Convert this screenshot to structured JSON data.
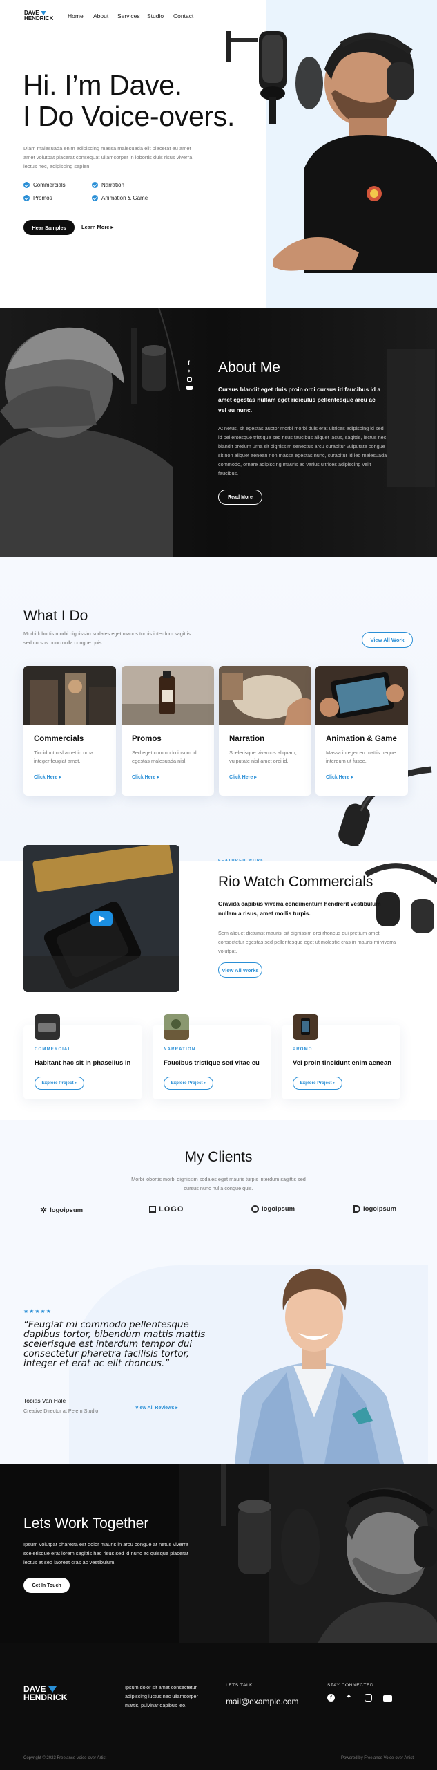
{
  "header": {
    "logo": [
      "DAVE",
      "HENDRICK"
    ],
    "nav": [
      "Home",
      "About",
      "Services",
      "Studio",
      "Contact"
    ]
  },
  "hero": {
    "title_line1": "Hi. I’m Dave.",
    "title_line2": "I Do Voice-overs.",
    "intro": "Diam malesuada enim adipiscing massa malesuada elit placerat eu amet amet volutpat placerat consequat ullamcorper in lobortis duis risus viverra lectus nec, adipiscing sapien.",
    "services": [
      "Commercials",
      "Narration",
      "Promos",
      "Animation & Game"
    ],
    "primary_btn": "Hear Samples",
    "secondary_btn": "Learn More"
  },
  "about": {
    "title": "About Me",
    "lead": "Cursus blandit eget duis proin orci cursus id faucibus id a amet egestas nullam eget ridiculus pellentesque arcu ac vel eu nunc.",
    "body": "At netus, sit egestas auctor morbi morbi duis erat ultrices adipiscing id sed id pellentesque tristique sed risus faucibus aliquet lacus, sagittis, lectus nec blandit pretium urna sit dignissim senectus arcu curabitur vulputate congue sit non aliquet aenean non massa egestas nunc, curabitur id leo malesuada commodo, ornare adipiscing mauris ac varius ultrices adipiscing velit faucibus.",
    "btn": "Read More"
  },
  "what": {
    "title": "What I Do",
    "sub": "Morbi lobortis morbi dignissim sodales eget mauris turpis interdum sagittis sed cursus nunc nulla congue quis.",
    "view_all": "View All Work",
    "cards": [
      {
        "title": "Commercials",
        "text": "Tincidunt nisl amet in urna integer feugiat amet.",
        "link": "Click Here"
      },
      {
        "title": "Promos",
        "text": "Sed eget commodo ipsum id egestas malesuada nisl.",
        "link": "Click Here"
      },
      {
        "title": "Narration",
        "text": "Scelerisque vivamus aliquam, vulputate nisl amet orci id.",
        "link": "Click Here"
      },
      {
        "title": "Animation & Game",
        "text": "Massa integer eu mattis neque interdum ut fusce.",
        "link": "Click Here"
      }
    ]
  },
  "featured": {
    "kicker": "FEATURED WORK",
    "title": "Rio Watch Commercials",
    "lead": "Gravida dapibus viverra condimentum hendrerit vestibulum nullam a risus, amet mollis turpis.",
    "body": "Sem aliquet dictumst mauris, sit dignissim orci rhoncus dui pretium amet consectetur egestas sed pellentesque eget ut molestie cras in mauris mi viverra volutpat.",
    "btn": "View All Works",
    "projects": [
      {
        "cat": "COMMERCIAL",
        "title": "Habitant hac sit in phasellus in",
        "btn": "Explore Project"
      },
      {
        "cat": "NARRATION",
        "title": "Faucibus tristique sed vitae eu",
        "btn": "Explore Project"
      },
      {
        "cat": "PROMO",
        "title": "Vel proin tincidunt enim aenean",
        "btn": "Explore Project"
      }
    ]
  },
  "clients": {
    "title": "My Clients",
    "sub": "Morbi lobortis morbi dignissim sodales eget mauris turpis interdum sagittis sed cursus nunc nulla congue quis.",
    "logos": [
      "logoipsum",
      "LOGO",
      "logoipsum",
      "logoipsum"
    ]
  },
  "testimonial": {
    "stars": "★★★★★",
    "quote": "“Feugiat mi commodo pellentesque dapibus tortor, bibendum mattis mattis scelerisque est interdum tempor dui consectetur pharetra facilisis tortor, integer et erat ac elit rhoncus.”",
    "name": "Tobias Van Hale",
    "role": "Creative Director at Pelem Studio",
    "link": "View All Reviews"
  },
  "cta": {
    "title": "Lets Work Together",
    "text": "Ipsum volutpat pharetra est dolor mauris in arcu congue at netus viverra scelerisque erat lorem sagittis hac risus sed id nunc ac quisque placerat lectus at sed laoreet cras ac vestibulum.",
    "btn": "Get In Touch"
  },
  "footer": {
    "logo": [
      "DAVE",
      "HENDRICK"
    ],
    "text": "Ipsum dolor sit amet consectetur adipiscing luctus nec ullamcorper mattis, pulvinar dapibus leo.",
    "talk_label": "LETS TALK",
    "email": "mail@example.com",
    "stay_label": "STAY CONNECTED",
    "copyright": "Copyright © 2023 Freelance Voice-over Artist",
    "powered": "Powered by Freelance Voice-over Artist"
  },
  "colors": {
    "accent": "#2a8fd6",
    "dark": "#0e0e0e",
    "light_blue": "#eaf4fd"
  }
}
